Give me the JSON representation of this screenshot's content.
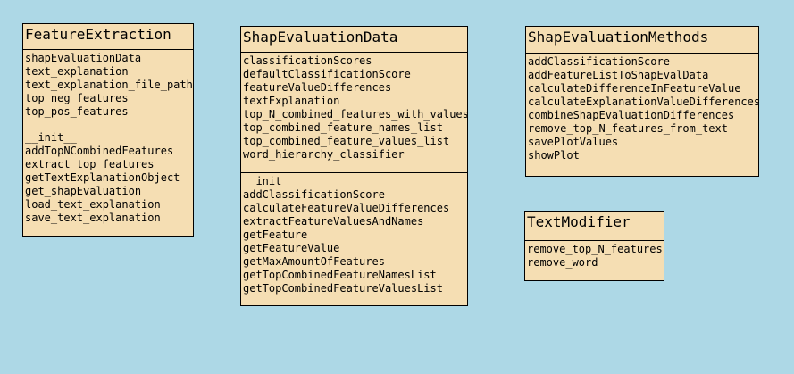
{
  "classes": {
    "feature_extraction": {
      "name": "FeatureExtraction",
      "attributes": [
        "shapEvaluationData",
        "text_explanation",
        "text_explanation_file_path",
        "top_neg_features",
        "top_pos_features"
      ],
      "methods": [
        "__init__",
        "addTopNCombinedFeatures",
        "extract_top_features",
        "getTextExplanationObject",
        "get_shapEvaluation",
        "load_text_explanation",
        "save_text_explanation"
      ]
    },
    "shap_evaluation_data": {
      "name": "ShapEvaluationData",
      "attributes": [
        "classificationScores",
        "defaultClassificationScore",
        "featureValueDifferences",
        "textExplanation",
        "top_N_combined_features_with_values",
        "top_combined_feature_names_list",
        "top_combined_feature_values_list",
        "word_hierarchy_classifier"
      ],
      "methods": [
        "__init__",
        "addClassificationScore",
        "calculateFeatureValueDifferences",
        "extractFeatureValuesAndNames",
        "getFeature",
        "getFeatureValue",
        "getMaxAmountOfFeatures",
        "getTopCombinedFeatureNamesList",
        "getTopCombinedFeatureValuesList"
      ]
    },
    "shap_evaluation_methods": {
      "name": "ShapEvaluationMethods",
      "attributes": [],
      "methods": [
        "addClassificationScore",
        "addFeatureListToShapEvalData",
        "calculateDifferenceInFeatureValue",
        "calculateExplanationValueDifferences",
        "combineShapEvaluationDifferences",
        "remove_top_N_features_from_text",
        "savePlotValues",
        "showPlot"
      ]
    },
    "text_modifier": {
      "name": "TextModifier",
      "attributes": [],
      "methods": [
        "remove_top_N_features",
        "remove_word"
      ]
    }
  },
  "colors": {
    "background": "#add8e6",
    "box_fill": "#f5deb3",
    "border": "#000000"
  }
}
